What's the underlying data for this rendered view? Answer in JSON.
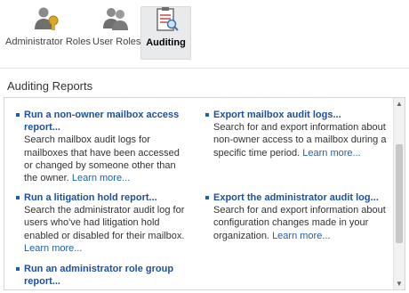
{
  "toolbar": {
    "admin_roles": "Administrator Roles",
    "user_roles": "User Roles",
    "auditing": "Auditing"
  },
  "section_title": "Auditing Reports",
  "reports": [
    {
      "title": "Run a non-owner mailbox access report...",
      "desc": "Search mailbox audit logs for mailboxes that have been accessed or changed by someone other than the owner.",
      "more": "Learn more..."
    },
    {
      "title": "Export mailbox audit logs...",
      "desc": "Search for and export information about non-owner access to a mailbox during a specific time period.",
      "more": "Learn more..."
    },
    {
      "title": "Run a litigation hold report...",
      "desc": "Search the administrator audit log for users who've had litigation hold enabled or disabled for their mailbox.",
      "more": "Learn more..."
    },
    {
      "title": "Export the administrator audit log...",
      "desc": "Search for and export information about configuration changes made in your organization.",
      "more": "Learn more..."
    },
    {
      "title": "Run an administrator role group report...",
      "desc": "",
      "more": ""
    }
  ],
  "scrollbar": {
    "up_arrow": "▲",
    "down_arrow": "▼"
  },
  "icons": {
    "admin_roles": "admin-roles-icon",
    "user_roles": "user-roles-icon",
    "auditing": "auditing-clipboard-icon"
  },
  "colors": {
    "link": "#1f4f9c",
    "active_tab_bg": "#e9eaeb",
    "scroll_thumb": "#c7c7c7"
  }
}
